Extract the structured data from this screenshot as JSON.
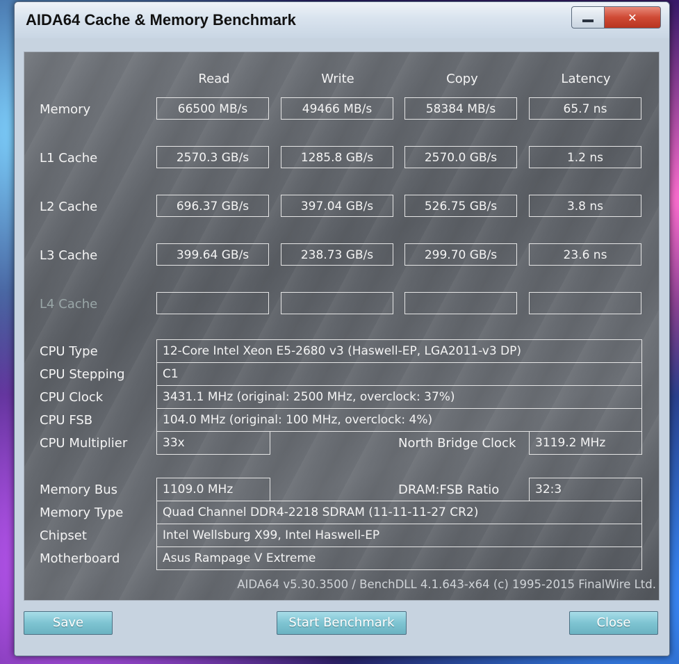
{
  "window": {
    "title": "AIDA64 Cache & Memory Benchmark",
    "minimize": "–",
    "close": "✕"
  },
  "columns": [
    "Read",
    "Write",
    "Copy",
    "Latency"
  ],
  "rows": [
    {
      "label": "Memory",
      "values": [
        "66500 MB/s",
        "49466 MB/s",
        "58384 MB/s",
        "65.7 ns"
      ]
    },
    {
      "label": "L1 Cache",
      "values": [
        "2570.3 GB/s",
        "1285.8 GB/s",
        "2570.0 GB/s",
        "1.2 ns"
      ]
    },
    {
      "label": "L2 Cache",
      "values": [
        "696.37 GB/s",
        "397.04 GB/s",
        "526.75 GB/s",
        "3.8 ns"
      ]
    },
    {
      "label": "L3 Cache",
      "values": [
        "399.64 GB/s",
        "238.73 GB/s",
        "299.70 GB/s",
        "23.6 ns"
      ]
    },
    {
      "label": "L4 Cache",
      "values": [
        "",
        "",
        "",
        ""
      ]
    }
  ],
  "info": {
    "cpu_type": {
      "label": "CPU Type",
      "value": "12-Core Intel Xeon E5-2680 v3  (Haswell-EP, LGA2011-v3 DP)"
    },
    "cpu_stepping": {
      "label": "CPU Stepping",
      "value": "C1"
    },
    "cpu_clock": {
      "label": "CPU Clock",
      "value": "3431.1 MHz  (original: 2500 MHz, overclock: 37%)"
    },
    "cpu_fsb": {
      "label": "CPU FSB",
      "value": "104.0 MHz  (original: 100 MHz, overclock: 4%)"
    },
    "cpu_multiplier": {
      "label": "CPU Multiplier",
      "value": "33x"
    },
    "north_bridge_clock": {
      "label": "North Bridge Clock",
      "value": "3119.2 MHz"
    },
    "memory_bus": {
      "label": "Memory Bus",
      "value": "1109.0 MHz"
    },
    "dram_fsb_ratio": {
      "label": "DRAM:FSB Ratio",
      "value": "32:3"
    },
    "memory_type": {
      "label": "Memory Type",
      "value": "Quad Channel DDR4-2218 SDRAM  (11-11-11-27 CR2)"
    },
    "chipset": {
      "label": "Chipset",
      "value": "Intel Wellsburg X99, Intel Haswell-EP"
    },
    "motherboard": {
      "label": "Motherboard",
      "value": "Asus Rampage V Extreme"
    }
  },
  "footer": "AIDA64 v5.30.3500 / BenchDLL 4.1.643-x64  (c) 1995-2015 FinalWire Ltd.",
  "buttons": {
    "save": "Save",
    "start": "Start Benchmark",
    "close": "Close"
  }
}
